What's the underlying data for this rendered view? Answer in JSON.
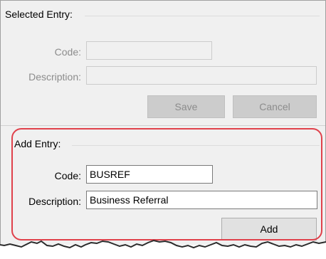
{
  "selected_entry": {
    "title": "Selected Entry:",
    "code_label": "Code:",
    "code_value": "",
    "description_label": "Description:",
    "description_value": "",
    "save_label": "Save",
    "cancel_label": "Cancel"
  },
  "add_entry": {
    "title": "Add Entry:",
    "code_label": "Code:",
    "code_value": "BUSREF",
    "description_label": "Description:",
    "description_value": "Business Referral",
    "add_label": "Add"
  },
  "colors": {
    "highlight": "#e0414b",
    "window_bg": "#f0f0f0"
  }
}
